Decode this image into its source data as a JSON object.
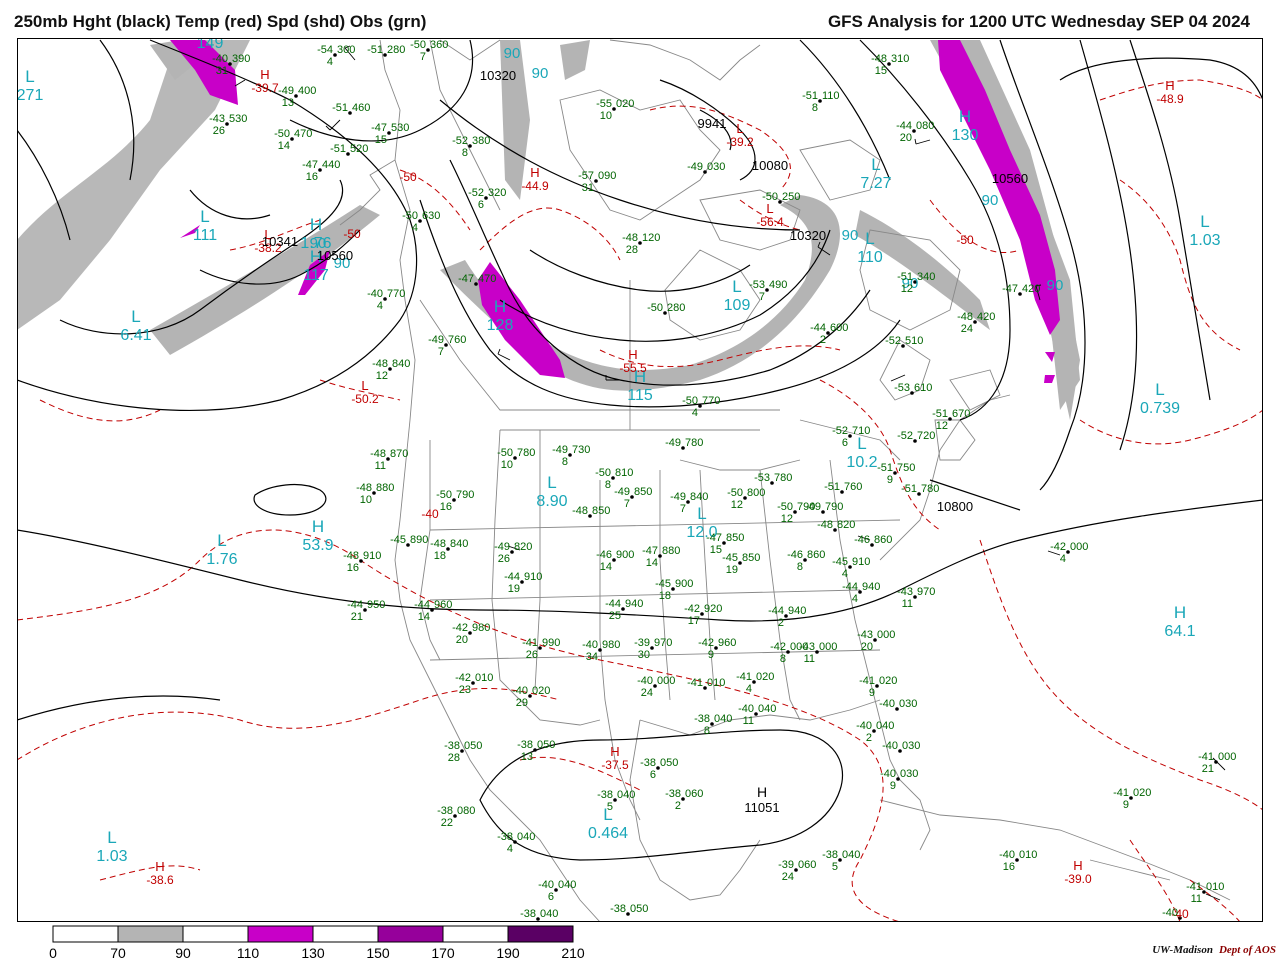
{
  "header": {
    "left_title": "250mb Hght (black) Temp (red) Spd (shd) Obs (grn)",
    "right_title": "GFS Analysis for 1200 UTC Wednesday  SEP 04 2024"
  },
  "credit": {
    "org": "UW-Madison",
    "dept": "Dept of AOS"
  },
  "colors": {
    "height": "#000000",
    "temp": "#c00000",
    "obs": "#006400",
    "speed_label": "#1aa7b8",
    "shade_70": "#b4b4b4",
    "shade_110": "#c800c8",
    "shade_150": "#96009b",
    "shade_190": "#5a0064",
    "geography": "#888888"
  },
  "legend": {
    "ticks": [
      "0",
      "70",
      "90",
      "110",
      "130",
      "150",
      "170",
      "190",
      "210"
    ],
    "bins": [
      {
        "from": "0",
        "to": "70",
        "color": "#ffffff"
      },
      {
        "from": "70",
        "to": "90",
        "color": "#b4b4b4"
      },
      {
        "from": "90",
        "to": "110",
        "color": "#ffffff"
      },
      {
        "from": "110",
        "to": "130",
        "color": "#c800c8"
      },
      {
        "from": "130",
        "to": "150",
        "color": "#ffffff"
      },
      {
        "from": "150",
        "to": "170",
        "color": "#96009b"
      },
      {
        "from": "170",
        "to": "190",
        "color": "#ffffff"
      },
      {
        "from": "190",
        "to": "210",
        "color": "#5a0064"
      }
    ]
  },
  "height_labels": [
    "10320",
    "9941",
    "10080",
    "10320",
    "10341",
    "10560",
    "10560",
    "10800",
    "11051"
  ],
  "height_centers": [
    {
      "letter": "H",
      "value": "11051"
    }
  ],
  "temp_centers": [
    {
      "letter": "H",
      "value": "-39.7"
    },
    {
      "letter": "L",
      "value": "-38.2"
    },
    {
      "letter": "H",
      "value": "-44.9"
    },
    {
      "letter": "L",
      "value": "-39.2"
    },
    {
      "letter": "L",
      "value": "-56.4"
    },
    {
      "letter": "H",
      "value": "-48.9"
    },
    {
      "letter": "L",
      "value": "-50.2"
    },
    {
      "letter": "H",
      "value": "-55.5"
    },
    {
      "letter": "H",
      "value": "-37.5"
    },
    {
      "letter": "H",
      "value": "-38.6"
    },
    {
      "letter": "H",
      "value": "-39.0"
    }
  ],
  "temp_contour_labels": [
    "-50",
    "-50",
    "-50",
    "-40",
    "-40"
  ],
  "speed_centers": [
    {
      "letter": "H",
      "value": "149"
    },
    {
      "letter": "L",
      "value": "271"
    },
    {
      "letter": "L",
      "value": "111"
    },
    {
      "letter": "L",
      "value": "6.41"
    },
    {
      "letter": "H",
      "value": "1.76"
    },
    {
      "letter": "L",
      "value": "7.27"
    },
    {
      "letter": "L",
      "value": "1.03"
    },
    {
      "letter": "L",
      "value": "109"
    },
    {
      "letter": "H",
      "value": "115"
    },
    {
      "letter": "L",
      "value": "0.739"
    },
    {
      "letter": "L",
      "value": "10.2"
    },
    {
      "letter": "L",
      "value": "8.90"
    },
    {
      "letter": "L",
      "value": "12.0"
    },
    {
      "letter": "H",
      "value": "53.9"
    },
    {
      "letter": "L",
      "value": "1.76"
    },
    {
      "letter": "H",
      "value": "64.1"
    },
    {
      "letter": "L",
      "value": "0.464"
    },
    {
      "letter": "L",
      "value": "1.03"
    },
    {
      "letter": "H",
      "value": "128"
    },
    {
      "letter": "H",
      "value": "130"
    },
    {
      "letter": "H",
      "value": "117"
    },
    {
      "letter": "L",
      "value": "110"
    }
  ],
  "speed_contour_labels": [
    "90",
    "90",
    "90",
    "90",
    "90",
    "90",
    "90",
    "90"
  ],
  "observations": [
    {
      "temp": "-54",
      "hgt": "300",
      "spd": "4"
    },
    {
      "temp": "-40",
      "hgt": "390",
      "spd": "31"
    },
    {
      "temp": "-51",
      "hgt": "280",
      "spd": ""
    },
    {
      "temp": "-50",
      "hgt": "360",
      "spd": "7"
    },
    {
      "temp": "-49",
      "hgt": "400",
      "spd": "13"
    },
    {
      "temp": "-51",
      "hgt": "460",
      "spd": ""
    },
    {
      "temp": "-43",
      "hgt": "530",
      "spd": "26"
    },
    {
      "temp": "-47",
      "hgt": "530",
      "spd": "15"
    },
    {
      "temp": "-50",
      "hgt": "470",
      "spd": "14"
    },
    {
      "temp": "-51",
      "hgt": "520",
      "spd": ""
    },
    {
      "temp": "-52",
      "hgt": "380",
      "spd": "8"
    },
    {
      "temp": "-47",
      "hgt": "440",
      "spd": "16"
    },
    {
      "temp": "-55",
      "hgt": "020",
      "spd": "10"
    },
    {
      "temp": "-57",
      "hgt": "090",
      "spd": "31"
    },
    {
      "temp": "-49",
      "hgt": "030",
      "spd": ""
    },
    {
      "temp": "-51",
      "hgt": "110",
      "spd": "8"
    },
    {
      "temp": "-52",
      "hgt": "320",
      "spd": "6"
    },
    {
      "temp": "-50",
      "hgt": "630",
      "spd": "4"
    },
    {
      "temp": "-48",
      "hgt": "120",
      "spd": "28"
    },
    {
      "temp": "-50",
      "hgt": "250",
      "spd": ""
    },
    {
      "temp": "-48",
      "hgt": "310",
      "spd": "15"
    },
    {
      "temp": "-44",
      "hgt": "080",
      "spd": "20"
    },
    {
      "temp": "-40",
      "hgt": "770",
      "spd": "4"
    },
    {
      "temp": "-47",
      "hgt": "470",
      "spd": ""
    },
    {
      "temp": "-50",
      "hgt": "280",
      "spd": ""
    },
    {
      "temp": "-53",
      "hgt": "490",
      "spd": "7"
    },
    {
      "temp": "-51",
      "hgt": "340",
      "spd": "12"
    },
    {
      "temp": "-48",
      "hgt": "420",
      "spd": "24"
    },
    {
      "temp": "-47",
      "hgt": "420",
      "spd": ""
    },
    {
      "temp": "-49",
      "hgt": "760",
      "spd": "7"
    },
    {
      "temp": "-44",
      "hgt": "600",
      "spd": "2"
    },
    {
      "temp": "-52",
      "hgt": "510",
      "spd": ""
    },
    {
      "temp": "-48",
      "hgt": "840",
      "spd": "12"
    },
    {
      "temp": "-50",
      "hgt": "770",
      "spd": "4"
    },
    {
      "temp": "-53",
      "hgt": "610",
      "spd": ""
    },
    {
      "temp": "-51",
      "hgt": "670",
      "spd": "12"
    },
    {
      "temp": "-52",
      "hgt": "710",
      "spd": "6"
    },
    {
      "temp": "-52",
      "hgt": "720",
      "spd": ""
    },
    {
      "temp": "-48",
      "hgt": "870",
      "spd": "11"
    },
    {
      "temp": "-50",
      "hgt": "780",
      "spd": "10"
    },
    {
      "temp": "-49",
      "hgt": "730",
      "spd": "8"
    },
    {
      "temp": "-49",
      "hgt": "780",
      "spd": ""
    },
    {
      "temp": "-51",
      "hgt": "750",
      "spd": "9"
    },
    {
      "temp": "-48",
      "hgt": "880",
      "spd": "10"
    },
    {
      "temp": "-50",
      "hgt": "790",
      "spd": "16"
    },
    {
      "temp": "-50",
      "hgt": "810",
      "spd": "8"
    },
    {
      "temp": "-49",
      "hgt": "850",
      "spd": "7"
    },
    {
      "temp": "-49",
      "hgt": "840",
      "spd": "7"
    },
    {
      "temp": "-50",
      "hgt": "800",
      "spd": "12"
    },
    {
      "temp": "-53",
      "hgt": "780",
      "spd": ""
    },
    {
      "temp": "-51",
      "hgt": "760",
      "spd": ""
    },
    {
      "temp": "-51",
      "hgt": "780",
      "spd": ""
    },
    {
      "temp": "-49",
      "hgt": "790",
      "spd": ""
    },
    {
      "temp": "-48",
      "hgt": "850",
      "spd": ""
    },
    {
      "temp": "-47",
      "hgt": "850",
      "spd": "15"
    },
    {
      "temp": "-50",
      "hgt": "790",
      "spd": "12"
    },
    {
      "temp": "-48",
      "hgt": "820",
      "spd": ""
    },
    {
      "temp": "-45",
      "hgt": "890",
      "spd": ""
    },
    {
      "temp": "-48",
      "hgt": "840",
      "spd": "18"
    },
    {
      "temp": "-49",
      "hgt": "820",
      "spd": "26"
    },
    {
      "temp": "-48",
      "hgt": "910",
      "spd": "16"
    },
    {
      "temp": "-46",
      "hgt": "900",
      "spd": "14"
    },
    {
      "temp": "-47",
      "hgt": "880",
      "spd": "14"
    },
    {
      "temp": "-45",
      "hgt": "850",
      "spd": "19"
    },
    {
      "temp": "-46",
      "hgt": "860",
      "spd": "8"
    },
    {
      "temp": "-46",
      "hgt": "860",
      "spd": ""
    },
    {
      "temp": "-44",
      "hgt": "910",
      "spd": "19"
    },
    {
      "temp": "-45",
      "hgt": "900",
      "spd": "18"
    },
    {
      "temp": "-44",
      "hgt": "950",
      "spd": "21"
    },
    {
      "temp": "-44",
      "hgt": "960",
      "spd": "14"
    },
    {
      "temp": "-44",
      "hgt": "940",
      "spd": "25"
    },
    {
      "temp": "-42",
      "hgt": "920",
      "spd": "17"
    },
    {
      "temp": "-44",
      "hgt": "940",
      "spd": "2"
    },
    {
      "temp": "-44",
      "hgt": "940",
      "spd": "4"
    },
    {
      "temp": "-43",
      "hgt": "970",
      "spd": "11"
    },
    {
      "temp": "-45",
      "hgt": "910",
      "spd": "4"
    },
    {
      "temp": "-42",
      "hgt": "980",
      "spd": "20"
    },
    {
      "temp": "-41",
      "hgt": "990",
      "spd": "26"
    },
    {
      "temp": "-40",
      "hgt": "980",
      "spd": "34"
    },
    {
      "temp": "-39",
      "hgt": "970",
      "spd": "30"
    },
    {
      "temp": "-42",
      "hgt": "960",
      "spd": "9"
    },
    {
      "temp": "-42",
      "hgt": "000",
      "spd": "8"
    },
    {
      "temp": "-43",
      "hgt": "000",
      "spd": "11"
    },
    {
      "temp": "-43",
      "hgt": "000",
      "spd": "20"
    },
    {
      "temp": "-42",
      "hgt": "010",
      "spd": "23"
    },
    {
      "temp": "-40",
      "hgt": "020",
      "spd": "29"
    },
    {
      "temp": "-40",
      "hgt": "000",
      "spd": "24"
    },
    {
      "temp": "-41",
      "hgt": "010",
      "spd": ""
    },
    {
      "temp": "-41",
      "hgt": "020",
      "spd": "4"
    },
    {
      "temp": "-41",
      "hgt": "020",
      "spd": "9"
    },
    {
      "temp": "-40",
      "hgt": "030",
      "spd": ""
    },
    {
      "temp": "-40",
      "hgt": "040",
      "spd": "2"
    },
    {
      "temp": "-38",
      "hgt": "040",
      "spd": "8"
    },
    {
      "temp": "-40",
      "hgt": "040",
      "spd": "11"
    },
    {
      "temp": "-40",
      "hgt": "030",
      "spd": ""
    },
    {
      "temp": "-40",
      "hgt": "030",
      "spd": "9"
    },
    {
      "temp": "-38",
      "hgt": "050",
      "spd": "28"
    },
    {
      "temp": "-38",
      "hgt": "050",
      "spd": "13"
    },
    {
      "temp": "-38",
      "hgt": "050",
      "spd": "6"
    },
    {
      "temp": "-38",
      "hgt": "040",
      "spd": "5"
    },
    {
      "temp": "-38",
      "hgt": "060",
      "spd": "2"
    },
    {
      "temp": "-38",
      "hgt": "080",
      "spd": "22"
    },
    {
      "temp": "-38",
      "hgt": "040",
      "spd": "4"
    },
    {
      "temp": "-39",
      "hgt": "060",
      "spd": "24"
    },
    {
      "temp": "-40",
      "hgt": "040",
      "spd": "6"
    },
    {
      "temp": "-38",
      "hgt": "040",
      "spd": "5"
    },
    {
      "temp": "-38",
      "hgt": "040",
      "spd": ""
    },
    {
      "temp": "-38",
      "hgt": "050",
      "spd": ""
    },
    {
      "temp": "-42",
      "hgt": "000",
      "spd": "4"
    },
    {
      "temp": "-41",
      "hgt": "000",
      "spd": "21"
    },
    {
      "temp": "-41",
      "hgt": "020",
      "spd": "9"
    },
    {
      "temp": "-40",
      "hgt": "010",
      "spd": "16"
    },
    {
      "temp": "-41",
      "hgt": "010",
      "spd": "11"
    },
    {
      "temp": "-40",
      "hgt": "",
      "spd": ""
    }
  ]
}
